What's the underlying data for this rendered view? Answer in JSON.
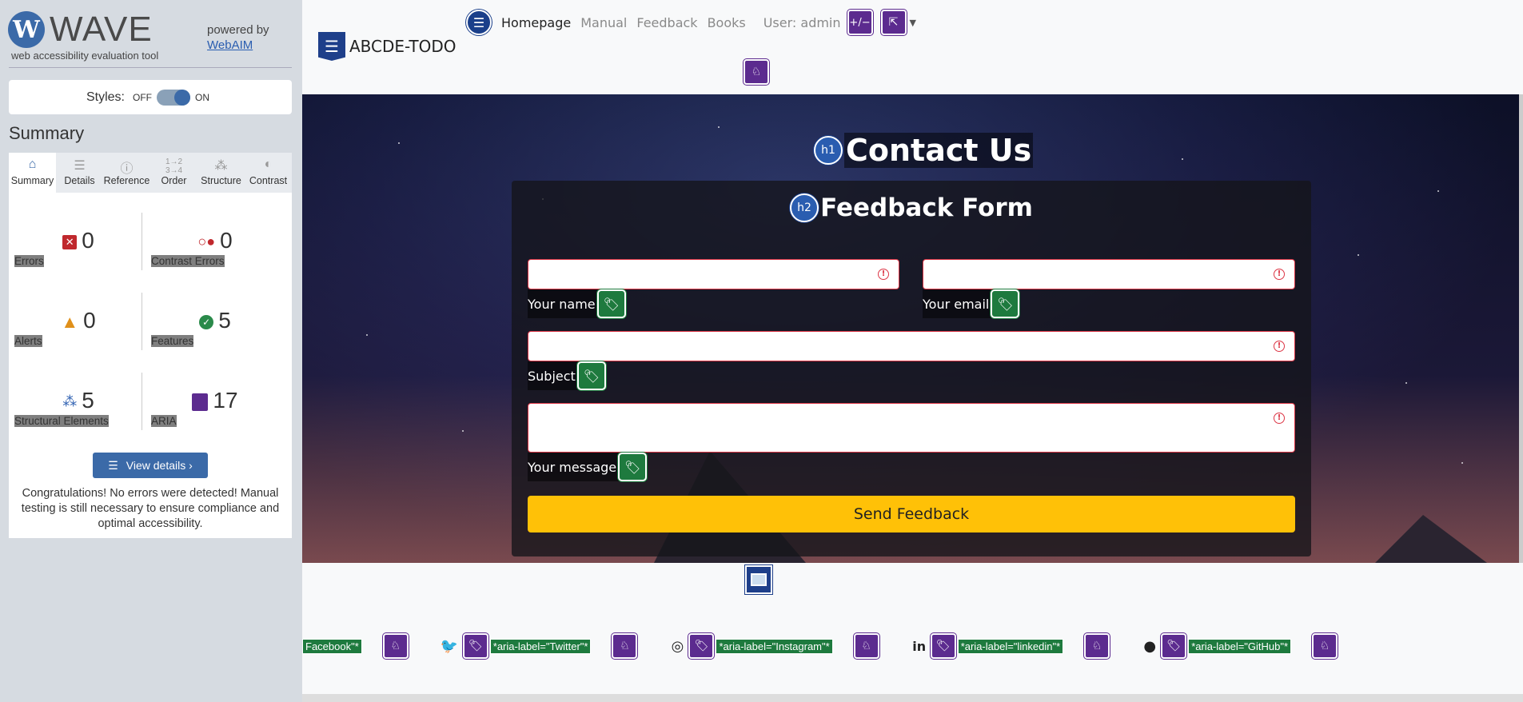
{
  "wave": {
    "logo_letter": "W",
    "logo_text": "WAVE",
    "tagline": "web accessibility evaluation tool",
    "powered_by": "powered by",
    "webaim": "WebAIM",
    "styles_label": "Styles:",
    "off": "OFF",
    "on": "ON",
    "summary_title": "Summary",
    "tabs": [
      {
        "label": "Summary",
        "icon": "home-icon"
      },
      {
        "label": "Details",
        "icon": "list-icon"
      },
      {
        "label": "Reference",
        "icon": "info-icon"
      },
      {
        "label": "Order",
        "icon": "order-icon"
      },
      {
        "label": "Structure",
        "icon": "structure-icon"
      },
      {
        "label": "Contrast",
        "icon": "contrast-icon"
      }
    ],
    "stats": {
      "errors": {
        "value": "0",
        "label": "Errors"
      },
      "contrast": {
        "value": "0",
        "label": "Contrast Errors"
      },
      "alerts": {
        "value": "0",
        "label": "Alerts"
      },
      "features": {
        "value": "5",
        "label": "Features"
      },
      "structural": {
        "value": "5",
        "label": "Structural Elements"
      },
      "aria": {
        "value": "17",
        "label": "ARIA"
      }
    },
    "view_details": "View details ›",
    "congrats": "Congratulations! No errors were detected! Manual testing is still necessary to ensure compliance and optimal accessibility."
  },
  "site": {
    "brand": "ABCDE-TODO",
    "nav": {
      "homepage": "Homepage",
      "manual": "Manual",
      "feedback": "Feedback",
      "books": "Books",
      "user": "User: admin",
      "plusminus": "+/−"
    },
    "h1_badge": "h1",
    "h1": "Contact Us",
    "h2_badge": "h2",
    "h2": "Feedback Form",
    "labels": {
      "name": "Your name",
      "email": "Your email",
      "subject": "Subject",
      "message": "Your message"
    },
    "send": "Send Feedback",
    "social": [
      {
        "label": "Facebook\"*",
        "icon": ""
      },
      {
        "label": "*aria-label=\"Twitter\"*",
        "icon": "twitter-icon"
      },
      {
        "label": "*aria-label=\"Instagram\"*",
        "icon": "instagram-icon"
      },
      {
        "label": "*aria-label=\"linkedin\"*",
        "icon": "linkedin-icon"
      },
      {
        "label": "*aria-label=\"GitHub\"*",
        "icon": "github-icon"
      }
    ]
  }
}
